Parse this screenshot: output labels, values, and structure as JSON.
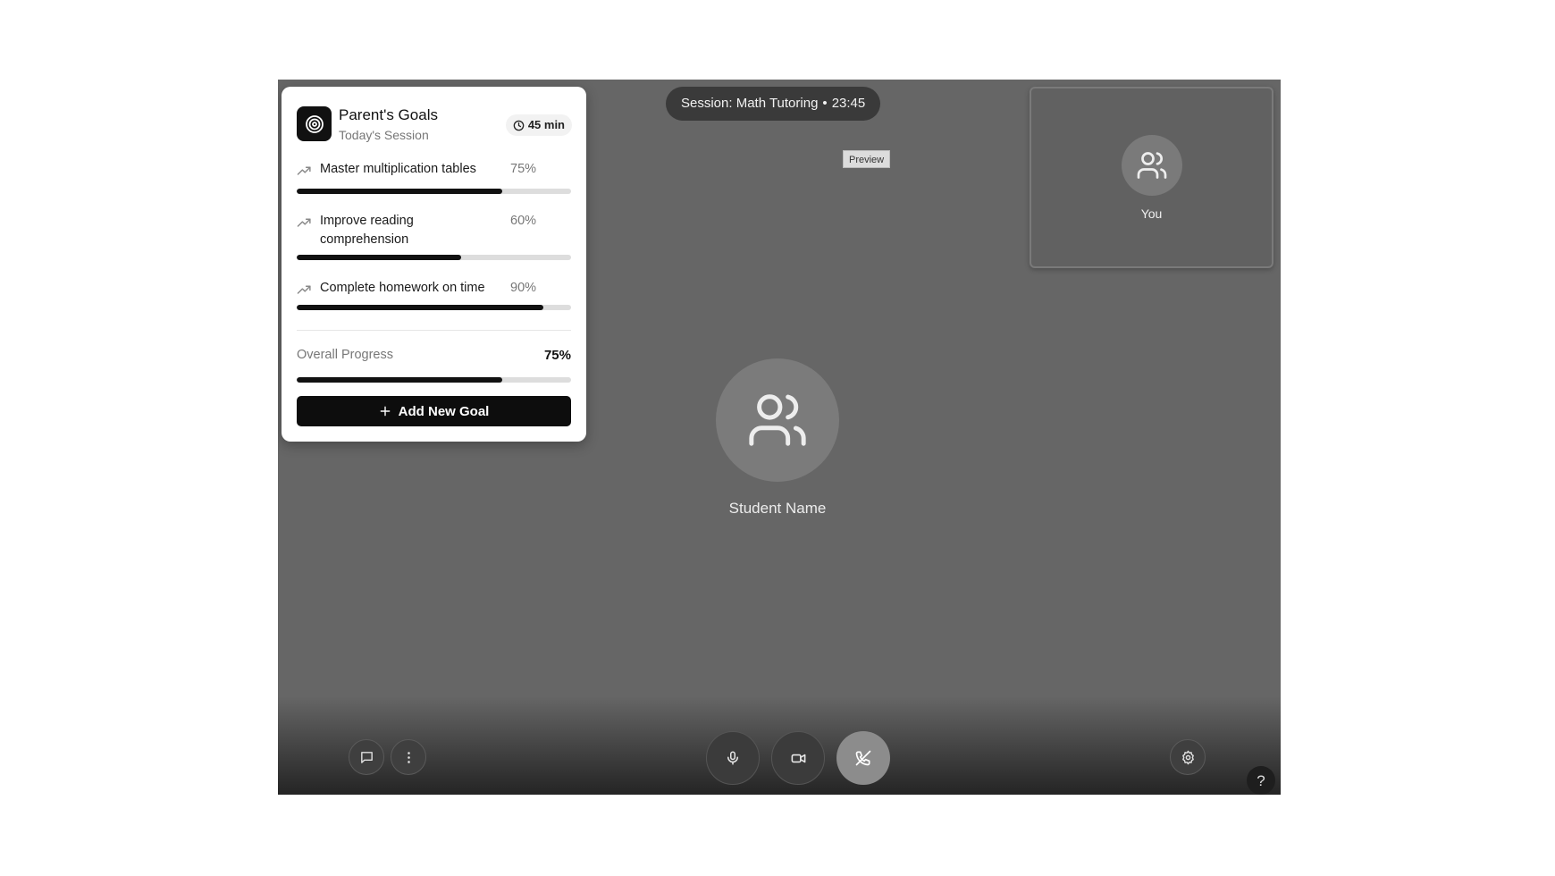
{
  "session": {
    "title": "Session: Math Tutoring",
    "separator": "•",
    "elapsed": "23:45"
  },
  "preview_tag": "Preview",
  "self_tile": {
    "label": "You",
    "icon": "users-icon"
  },
  "main_participant": {
    "name": "Student Name",
    "icon": "users-icon"
  },
  "goals_panel": {
    "title": "Parent's Goals",
    "subtitle": "Today's Session",
    "duration": "45 min",
    "goals": [
      {
        "label": "Master multiplication tables",
        "percent_text": "75%",
        "progress": 0.75
      },
      {
        "label": "Improve reading comprehension",
        "percent_text": "60%",
        "progress": 0.6
      },
      {
        "label": "Complete homework on time",
        "percent_text": "90%",
        "progress": 0.9
      }
    ],
    "overall": {
      "label": "Overall Progress",
      "percent_text": "75%",
      "progress": 0.75
    },
    "add_button_label": "Add New Goal"
  },
  "controls": {
    "left": [
      "chat-icon",
      "more-vertical-icon"
    ],
    "center": [
      "microphone-icon",
      "video-camera-icon",
      "end-call-icon"
    ],
    "right": [
      "gear-icon"
    ],
    "help_label": "?"
  },
  "colors": {
    "stage_bg": "#666666",
    "panel_bg": "#ffffff",
    "accent": "#111111",
    "bar_track": "#dddddd"
  }
}
